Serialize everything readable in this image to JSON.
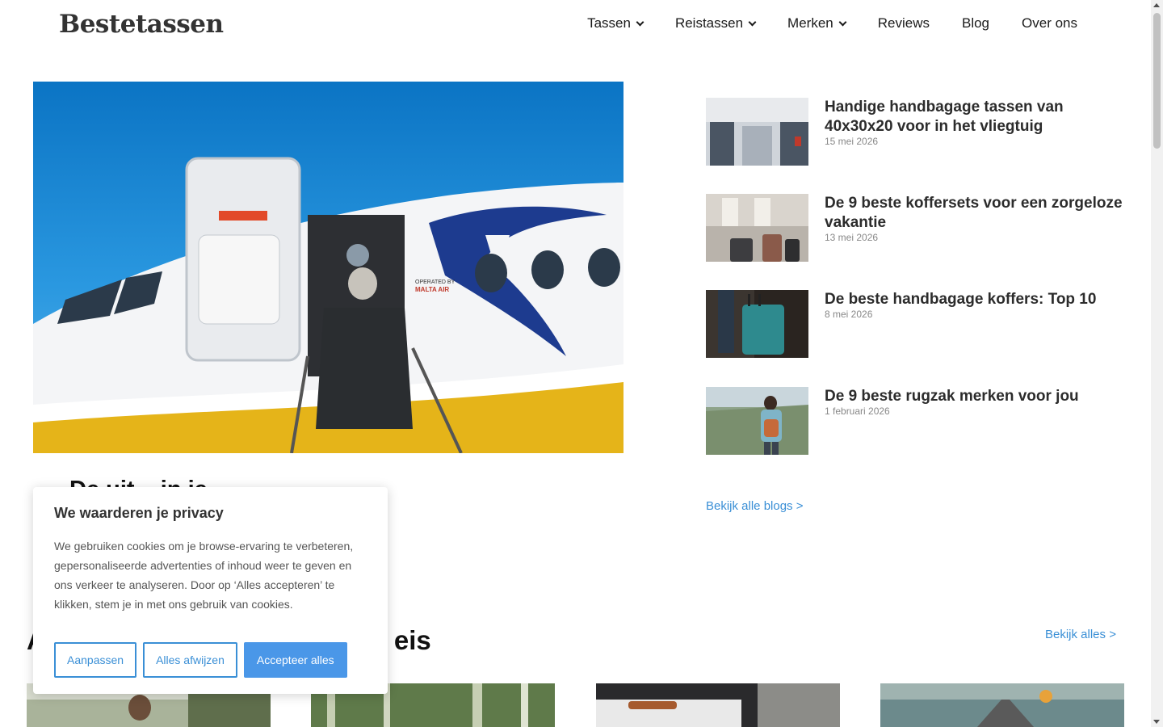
{
  "header": {
    "logo": "Bestetassen",
    "nav": [
      {
        "label": "Tassen",
        "dropdown": true
      },
      {
        "label": "Reistassen",
        "dropdown": true
      },
      {
        "label": "Merken",
        "dropdown": true
      },
      {
        "label": "Reviews",
        "dropdown": false
      },
      {
        "label": "Blog",
        "dropdown": false
      },
      {
        "label": "Over ons",
        "dropdown": false
      }
    ]
  },
  "hero": {
    "title": "De uit... in je",
    "image_icon": "airplane-boarding-photo"
  },
  "posts": [
    {
      "title": "Handige handbagage tassen van 40x30x20 voor in het vliegtuig",
      "date": "15 mei 2026"
    },
    {
      "title": "De 9 beste koffersets voor een zorgeloze vakantie",
      "date": "13 mei 2026"
    },
    {
      "title": "De beste handbagage koffers: Top 10",
      "date": "8 mei 2026"
    },
    {
      "title": "De 9 beste rugzak merken voor jou",
      "date": "1 februari 2026"
    }
  ],
  "blog_link": "Bekijk alle blogs >",
  "section": {
    "title_left": "A",
    "title_right": "eis",
    "view_all": "Bekijk alles >"
  },
  "cookie": {
    "title": "We waarderen je privacy",
    "text": "We gebruiken cookies om je browse-ervaring te verbeteren, gepersonaliseerde advertenties of inhoud weer te geven en ons verkeer te analyseren. Door op ‘Alles accepteren’ te klikken, stem je in met ons gebruik van cookies.",
    "buttons": {
      "customize": "Aanpassen",
      "reject": "Alles afwijzen",
      "accept": "Accepteer alles"
    }
  },
  "colors": {
    "accent": "#3a8fd6",
    "accept_button": "#4a97e8"
  }
}
